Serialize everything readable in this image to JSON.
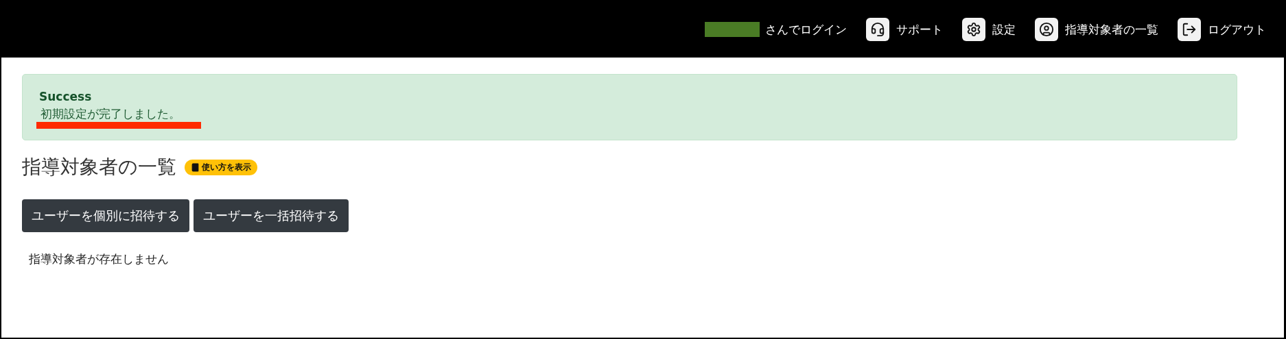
{
  "header": {
    "login_text": "さんでログイン",
    "nav": [
      {
        "label": "サポート"
      },
      {
        "label": "設定"
      },
      {
        "label": "指導対象者の一覧"
      },
      {
        "label": "ログアウト"
      }
    ]
  },
  "alert": {
    "title": "Success",
    "message": "初期設定が完了しました。"
  },
  "page": {
    "title": "指導対象者の一覧",
    "help_badge": "使い方を表示",
    "buttons": [
      "ユーザーを個別に招待する",
      "ユーザーを一括招待する"
    ],
    "empty_text": "指導対象者が存在しません"
  }
}
